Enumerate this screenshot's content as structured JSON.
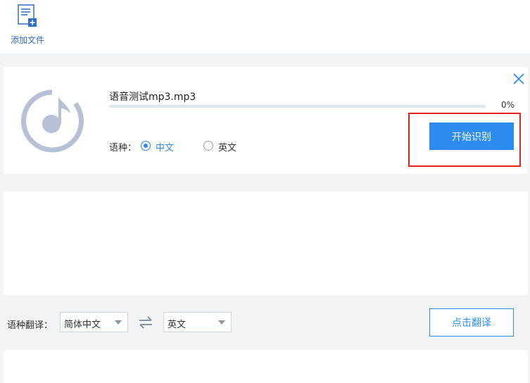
{
  "toolbar": {
    "add_file_label": "添加文件"
  },
  "file_card": {
    "file_name": "语音测试mp3.mp3",
    "progress_fraction": 0.0,
    "progress_text": "0%",
    "language_label": "语种：",
    "language_options": [
      "中文",
      "英文"
    ],
    "selected_language": "中文",
    "start_button_label": "开始识别"
  },
  "translate_bar": {
    "label": "语种翻译：",
    "source_language": "简体中文",
    "target_language": "英文",
    "translate_button_label": "点击翻译"
  },
  "colors": {
    "accent": "#2d8cf0",
    "highlight": "#e8221c",
    "icon_gray": "#b7c1d6"
  },
  "icons": [
    "add-file-icon",
    "close-icon",
    "music-note-icon",
    "swap-icon",
    "caret-down-icon"
  ]
}
